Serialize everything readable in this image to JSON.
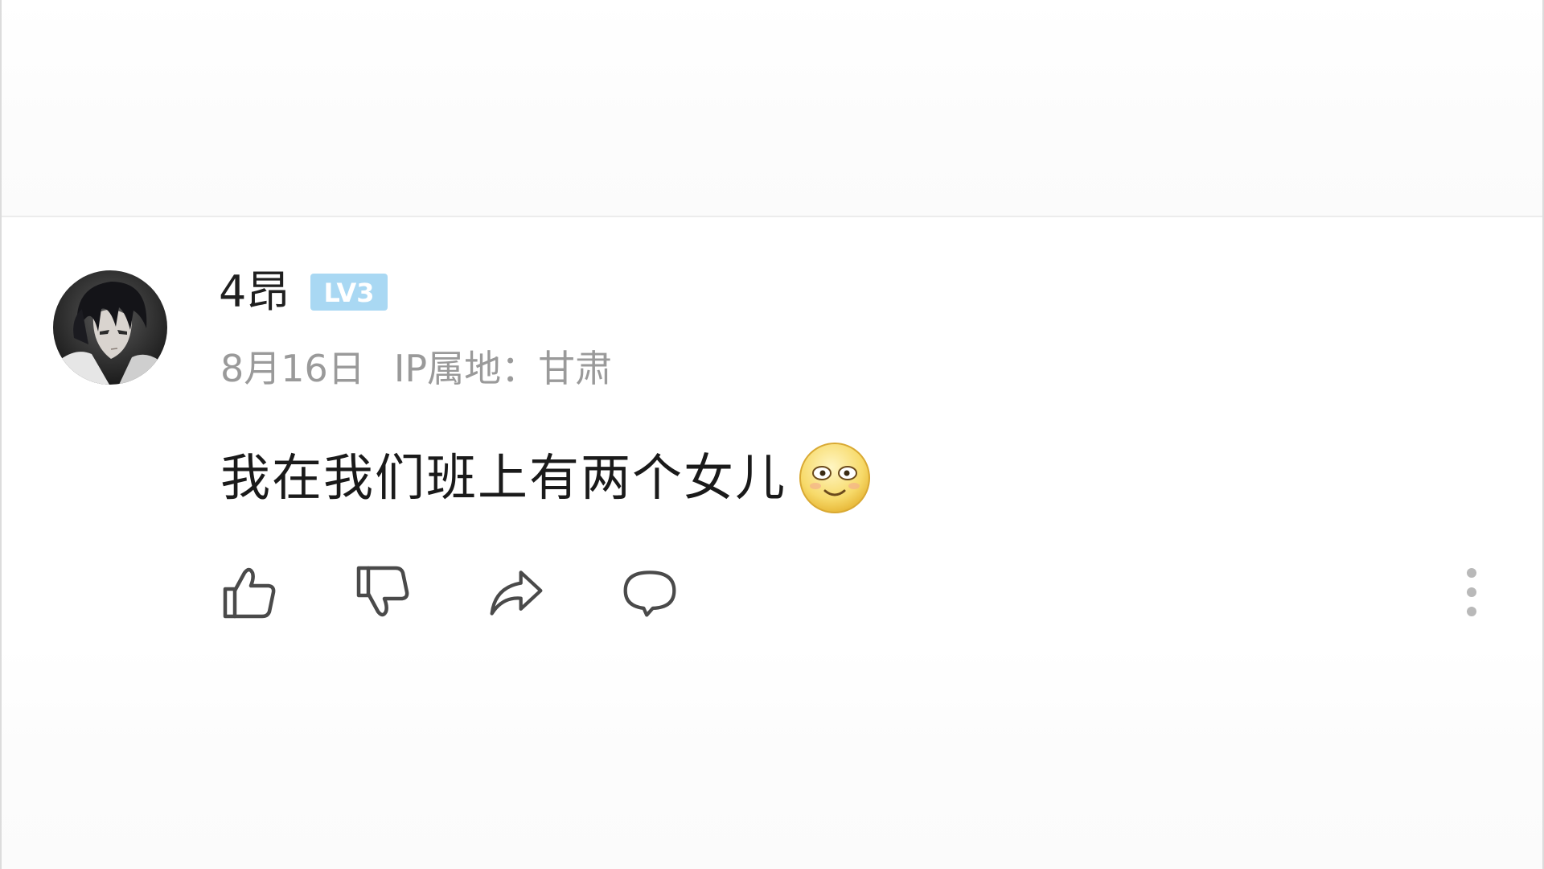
{
  "comment": {
    "author": {
      "name": "4昂",
      "level_badge": "LV3",
      "avatar_icon": "anime-portrait-avatar"
    },
    "date": "8月16日",
    "ip_location": "IP属地：甘肃",
    "text": "我在我们班上有两个女儿",
    "emoji": "flushed-smile-emoji"
  },
  "actions": {
    "like_icon": "thumbs-up-icon",
    "dislike_icon": "thumbs-down-icon",
    "share_icon": "share-arrow-icon",
    "reply_icon": "speech-bubble-icon",
    "more_icon": "vertical-ellipsis-icon"
  },
  "colors": {
    "badge_bg": "#a9d8f3",
    "badge_fg": "#ffffff",
    "meta_text": "#9a9a9a",
    "icon_stroke": "#4a4a4a",
    "more_dots": "#b9b9b9"
  }
}
